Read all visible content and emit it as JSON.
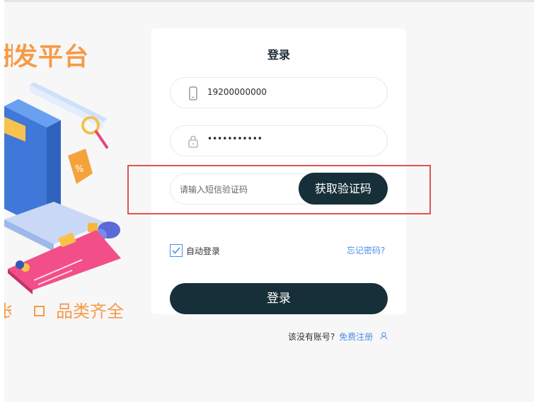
{
  "promo": {
    "title": "批发平台",
    "title_visible": "发平台",
    "feature_fragment": "长",
    "feature": "品类齐全"
  },
  "login": {
    "title": "登录",
    "phone_value": "19200000000",
    "password_mask": "•••••••••••",
    "code_placeholder": "请输入短信验证码",
    "code_button": "获取验证码",
    "remember_label": "自动登录",
    "remember_checked": true,
    "forgot_link": "忘记密码?",
    "submit_button": "登录",
    "register_question": "该没有账号?",
    "register_link": "免费注册"
  },
  "colors": {
    "accent_orange": "#f79a45",
    "button_dark": "#172f38",
    "link_blue": "#4a8fe7",
    "highlight_red": "#e05454"
  }
}
